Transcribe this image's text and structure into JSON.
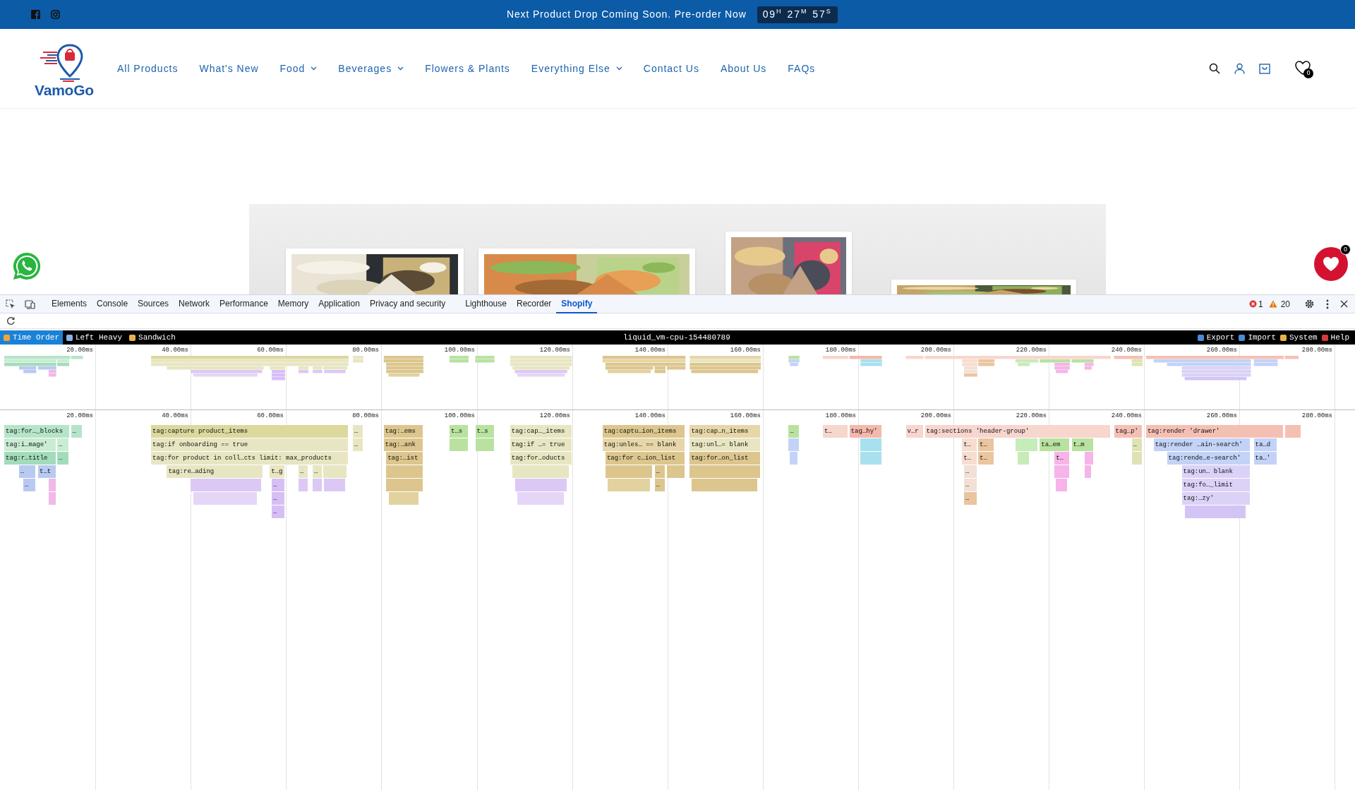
{
  "announcement": {
    "social": [
      {
        "kind": "facebook"
      },
      {
        "kind": "instagram"
      }
    ],
    "text": "Next Product Drop Coming Soon. Pre-order Now",
    "countdown": [
      {
        "value": "09",
        "unit": "H"
      },
      {
        "value": "27",
        "unit": "M"
      },
      {
        "value": "57",
        "unit": "S"
      }
    ]
  },
  "header": {
    "logo": "VamoGo",
    "nav": [
      {
        "label": "All Products",
        "dropdown": false
      },
      {
        "label": "What's New",
        "dropdown": false
      },
      {
        "label": "Food",
        "dropdown": true
      },
      {
        "label": "Beverages",
        "dropdown": true
      },
      {
        "label": "Flowers & Plants",
        "dropdown": false
      },
      {
        "label": "Everything Else",
        "dropdown": true
      },
      {
        "label": "Contact Us",
        "dropdown": false
      },
      {
        "label": "About Us",
        "dropdown": false
      },
      {
        "label": "FAQs",
        "dropdown": false
      }
    ],
    "wishlist_count": "0"
  },
  "floating": {
    "wishlist_count": "0"
  },
  "devtools": {
    "tabs": [
      {
        "label": "Elements",
        "selected": false
      },
      {
        "label": "Console",
        "selected": false
      },
      {
        "label": "Sources",
        "selected": false
      },
      {
        "label": "Network",
        "selected": false
      },
      {
        "label": "Performance",
        "selected": false
      },
      {
        "label": "Memory",
        "selected": false
      },
      {
        "label": "Application",
        "selected": false
      },
      {
        "label": "Privacy and security",
        "selected": false
      },
      {
        "label": "Lighthouse",
        "selected": false
      },
      {
        "label": "Recorder",
        "selected": false
      },
      {
        "label": "Shopify",
        "selected": true
      }
    ],
    "errors": "1",
    "warnings": "20"
  },
  "profiler": {
    "views": [
      {
        "label": "Time Order",
        "selected": true
      },
      {
        "label": "Left Heavy",
        "selected": false
      },
      {
        "label": "Sandwich",
        "selected": false
      }
    ],
    "title": "liquid_vm-cpu-154480789",
    "actions": [
      "Export",
      "Import",
      "System",
      "Help"
    ],
    "minimap_ticks": [
      "20.00ms",
      "40.00ms",
      "60.00ms",
      "80.00ms",
      "100.00ms",
      "120.00ms",
      "140.00ms",
      "160.00ms",
      "180.00ms",
      "200.00ms",
      "220.00ms",
      "240.00ms",
      "260.00ms",
      "280.00ms"
    ],
    "ticks": [
      "20.00ms",
      "40.00ms",
      "60.00ms",
      "80.00ms",
      "100.00ms",
      "120.00ms",
      "140.00ms",
      "160.00ms",
      "180.00ms",
      "200.00ms",
      "220.00ms",
      "240.00ms",
      "260.00ms",
      "280.00ms"
    ],
    "frames": [
      {
        "label": "tag:for…_blocks",
        "color": "#b5e5c9",
        "children": [
          {
            "label": "tag:i…mage'",
            "color": "#c9ecd5",
            "children": [
              {
                "label": "tag:r…title",
                "color": "#a3dcbb",
                "children": [
                  {
                    "label": "…",
                    "color": "#b8caf2",
                    "children": [
                      {
                        "label": "…",
                        "color": "#b8caf2"
                      }
                    ]
                  },
                  {
                    "label": "t…t",
                    "color": "#b8caf2",
                    "children": [
                      {
                        "color": "#f1b8e8",
                        "children": [
                          {
                            "color": "#f1b8e8"
                          }
                        ]
                      }
                    ]
                  }
                ]
              }
            ]
          },
          {
            "label": "…",
            "color": "#c9ecd5",
            "children": [
              {
                "label": "…",
                "color": "#a3dcbb"
              }
            ]
          }
        ]
      },
      {
        "label": "…",
        "color": "#b5e5c9"
      },
      {
        "label": "tag:capture product_items",
        "color": "#dcd89e",
        "children": [
          {
            "label": "tag:if onboarding == true",
            "color": "#e8e6c2",
            "children": [
              {
                "label": "tag:for product in coll…cts limit: max_products",
                "color": "#e8e6c2",
                "children": [
                  {
                    "label": "tag:re…ading",
                    "color": "#e8e6c2",
                    "children": [
                      {
                        "color": "#dcc8f5",
                        "children": [
                          {
                            "color": "#e5d6f8"
                          }
                        ]
                      }
                    ]
                  },
                  {
                    "label": "t…g",
                    "color": "#e8e6c2",
                    "children": [
                      {
                        "label": "…",
                        "color": "#d7bff5",
                        "children": [
                          {
                            "label": "…",
                            "color": "#d7bff5",
                            "children": [
                              {
                                "label": "…",
                                "color": "#d7bff5"
                              }
                            ]
                          }
                        ]
                      }
                    ]
                  },
                  {
                    "label": "…",
                    "color": "#e8e6c2",
                    "children": [
                      {
                        "color": "#dcc8f5"
                      }
                    ]
                  },
                  {
                    "label": "…",
                    "color": "#e8e6c2",
                    "children": [
                      {
                        "color": "#dcc8f5"
                      }
                    ]
                  },
                  {
                    "color": "#e8e6c2",
                    "children": [
                      {
                        "color": "#dcc8f5"
                      }
                    ]
                  }
                ]
              }
            ]
          }
        ]
      },
      {
        "label": "…",
        "color": "#e8e6c2",
        "children": [
          {
            "label": "…",
            "color": "#e8e6c2"
          }
        ]
      },
      {
        "label": "tag:…ems",
        "color": "#dcc68e",
        "children": [
          {
            "label": "tag:…ank",
            "color": "#dcc68e",
            "children": [
              {
                "label": "tag:…ist",
                "color": "#dcc68e",
                "children": [
                  {
                    "color": "#dcc68e",
                    "children": [
                      {
                        "color": "#dcc68e",
                        "children": [
                          {
                            "color": "#e2d29f"
                          }
                        ]
                      }
                    ]
                  }
                ]
              }
            ]
          }
        ]
      },
      {
        "label": "t…s",
        "color": "#b9e2a0",
        "children": [
          {
            "color": "#b9e2a0"
          }
        ]
      },
      {
        "label": "t…s",
        "color": "#b9e2a0",
        "children": [
          {
            "color": "#b9e2a0"
          }
        ]
      },
      {
        "label": "tag:cap…_items",
        "color": "#e8e6c2",
        "children": [
          {
            "label": "tag:if …= true",
            "color": "#e8e6c2",
            "children": [
              {
                "label": "tag:for…oducts",
                "color": "#e8e6c2",
                "children": [
                  {
                    "color": "#e8e6c2",
                    "children": [
                      {
                        "color": "#dcc8f5",
                        "children": [
                          {
                            "color": "#e5d6f8"
                          }
                        ]
                      }
                    ]
                  }
                ]
              }
            ]
          }
        ]
      },
      {
        "label": "tag:captu…ion_items",
        "color": "#dcc68e",
        "children": [
          {
            "label": "tag:unles… == blank",
            "color": "#e6d6a8",
            "children": [
              {
                "label": "tag:for c…ion_list",
                "color": "#dcc68e",
                "children": [
                  {
                    "color": "#dcc68e",
                    "children": [
                      {
                        "color": "#e2d29f"
                      }
                    ]
                  },
                  {
                    "label": "…",
                    "color": "#dcc68e",
                    "children": [
                      {
                        "label": "…",
                        "color": "#dcc68e"
                      }
                    ]
                  },
                  {
                    "color": "#dcc68e"
                  }
                ]
              }
            ]
          }
        ]
      },
      {
        "label": "tag:cap…n_items",
        "color": "#e6d6a8",
        "children": [
          {
            "label": "tag:unl…= blank",
            "color": "#e8e6c2",
            "children": [
              {
                "label": "tag:for…on_list",
                "color": "#dcc68e",
                "children": [
                  {
                    "color": "#dcc68e",
                    "children": [
                      {
                        "color": "#dcc68e"
                      }
                    ]
                  }
                ]
              }
            ]
          }
        ]
      },
      {
        "label": "…",
        "color": "#b9e2a0",
        "children": [
          {
            "color": "#c3d3f7",
            "children": [
              {
                "color": "#c3d3f7"
              }
            ]
          }
        ]
      },
      {
        "label": "t…",
        "color": "#f7d6cd"
      },
      {
        "label": "tag…hy'",
        "color": "#f5b8ac",
        "children": [
          {
            "color": "#a9e0ee",
            "children": [
              {
                "color": "#a9e0ee"
              }
            ]
          }
        ]
      },
      {
        "label": "v…r",
        "color": "#f7d6cd"
      },
      {
        "label": "tag:sections 'header-group'",
        "color": "#f7d6cd",
        "children": [
          {
            "label": "t…",
            "color": "#f7ddd0",
            "children": [
              {
                "label": "t…",
                "color": "#f7ddd0",
                "children": [
                  {
                    "label": "…",
                    "color": "#f2e0d6",
                    "children": [
                      {
                        "label": "…",
                        "color": "#f2e0d6",
                        "children": [
                          {
                            "label": "…",
                            "color": "#eac59f"
                          }
                        ]
                      }
                    ]
                  }
                ]
              }
            ]
          },
          {
            "label": "t…",
            "color": "#eac59f",
            "children": [
              {
                "label": "t…",
                "color": "#eac59f"
              }
            ]
          },
          {
            "color": "#c6ecb9",
            "children": [
              {
                "color": "#c6ecb9"
              }
            ]
          },
          {
            "label": "ta…em",
            "color": "#b9e2a0",
            "children": [
              {
                "label": "t…",
                "color": "#f6b4e8",
                "children": [
                  {
                    "color": "#f6b4e8",
                    "children": [
                      {
                        "color": "#f6b4e8"
                      }
                    ]
                  }
                ]
              }
            ]
          },
          {
            "label": "t…m",
            "color": "#b9e2a0",
            "children": [
              {
                "color": "#f6b4e8",
                "children": [
                  {
                    "color": "#f6b4e8"
                  }
                ]
              }
            ]
          }
        ]
      },
      {
        "label": "tag…p'",
        "color": "#f5c0b4",
        "children": [
          {
            "label": "…",
            "color": "#dfe3b4",
            "children": [
              {
                "color": "#dfe3b4"
              }
            ]
          }
        ]
      },
      {
        "label": "tag:render 'drawer'",
        "color": "#f5c0b4",
        "children": [
          {
            "label": "tag:render …ain-search'",
            "color": "#c3d3f7",
            "children": [
              {
                "label": "tag:rende…e-search'",
                "color": "#c3d3f7",
                "children": [
                  {
                    "label": "tag:un… blank",
                    "color": "#dcd2f7",
                    "children": [
                      {
                        "label": "tag:fo…_limit",
                        "color": "#dcd2f7",
                        "children": [
                          {
                            "label": "tag:…zy'",
                            "color": "#dcd2f7",
                            "children": [
                              {
                                "color": "#d3c4f5"
                              }
                            ]
                          }
                        ]
                      }
                    ]
                  }
                ]
              }
            ]
          },
          {
            "label": "ta…d",
            "color": "#c3d3f7",
            "children": [
              {
                "label": "ta…'",
                "color": "#c3d3f7"
              }
            ]
          }
        ]
      },
      {
        "color": "#f5c0b4"
      }
    ]
  }
}
